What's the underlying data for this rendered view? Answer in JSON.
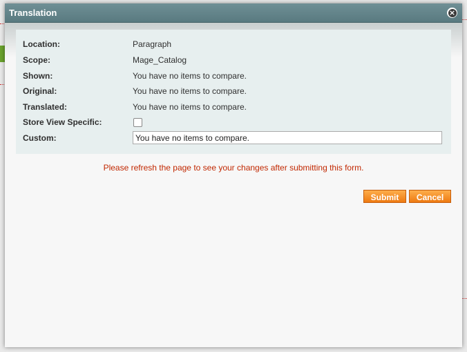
{
  "dialog": {
    "title": "Translation",
    "close_icon": "close-icon"
  },
  "form": {
    "fields": [
      {
        "label": "Location:",
        "value": "Paragraph"
      },
      {
        "label": "Scope:",
        "value": "Mage_Catalog"
      },
      {
        "label": "Shown:",
        "value": "You have no items to compare."
      },
      {
        "label": "Original:",
        "value": "You have no items to compare."
      },
      {
        "label": "Translated:",
        "value": "You have no items to compare."
      }
    ],
    "store_view_specific": {
      "label": "Store View Specific:",
      "checked": false
    },
    "custom": {
      "label": "Custom:",
      "value": "You have no items to compare."
    }
  },
  "notice": "Please refresh the page to see your changes after submitting this form.",
  "buttons": {
    "submit": "Submit",
    "cancel": "Cancel"
  },
  "colors": {
    "titlebar": "#5f8086",
    "form_background": "#e7efef",
    "notice_text": "#c12700",
    "button": "#f18a1e"
  }
}
